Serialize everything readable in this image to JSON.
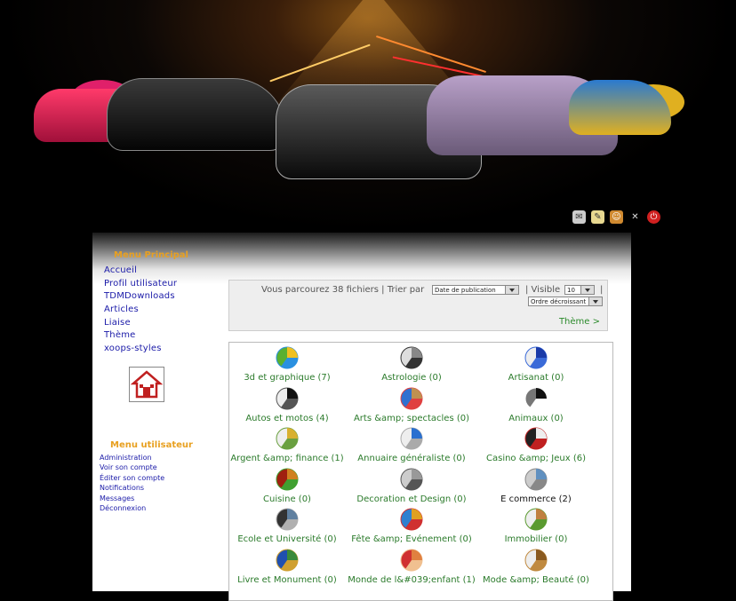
{
  "header_icons": [
    "chat-icon",
    "notes-icon",
    "users-icon",
    "tools-icon",
    "power-icon"
  ],
  "sidebar": {
    "main_menu_title": "Menu Principal",
    "main_menu": [
      "Accueil",
      "Profil utilisateur",
      "TDMDownloads",
      "Articles",
      "Liaise",
      "Thème",
      "xoops-styles"
    ],
    "user_menu_title": "Menu utilisateur",
    "user_menu": [
      "Administration",
      "Voir son compte",
      "Éditer son compte",
      "Notifications",
      "Messages",
      "Déconnexion"
    ]
  },
  "toolbar": {
    "browse_text": "Vous parcourez 38 fichiers | Trier par",
    "sort_value": "Date de publication",
    "visible_label": "| Visible",
    "visible_value": "10",
    "sep": "|",
    "order_value": "Ordre décroissant",
    "theme_link": "Thème >"
  },
  "categories": [
    {
      "label": "3d et graphique (7)",
      "icon": "pie-chart-icon",
      "colors": [
        "#f0c020",
        "#2a90e0",
        "#5ab030"
      ]
    },
    {
      "label": "Astrologie (0)",
      "icon": "zodiac-icon",
      "colors": [
        "#888",
        "#333",
        "#ddd"
      ]
    },
    {
      "label": "Artisanat (0)",
      "icon": "craft-icon",
      "colors": [
        "#1a3aa8",
        "#3a6ad8",
        "#eee"
      ]
    },
    {
      "label": "Autos et motos (4)",
      "icon": "car-icon",
      "colors": [
        "#111",
        "#555",
        "#eee"
      ]
    },
    {
      "label": "Arts &amp; spectacles (0)",
      "icon": "palette-icon",
      "colors": [
        "#c09050",
        "#e04040",
        "#3070d0"
      ]
    },
    {
      "label": "Animaux (0)",
      "icon": "panda-icon",
      "colors": [
        "#111",
        "#fff",
        "#777"
      ]
    },
    {
      "label": "Argent &amp; finance (1)",
      "icon": "money-icon",
      "colors": [
        "#d8b030",
        "#6aa040",
        "#eee"
      ]
    },
    {
      "label": "Annuaire généraliste (0)",
      "icon": "search-icon",
      "colors": [
        "#2a70d0",
        "#aaa",
        "#eee"
      ]
    },
    {
      "label": "Casino &amp; Jeux (6)",
      "icon": "cards-icon",
      "colors": [
        "#eee",
        "#c02020",
        "#222"
      ]
    },
    {
      "label": "Cuisine (0)",
      "icon": "burger-icon",
      "colors": [
        "#d08020",
        "#40a030",
        "#a02010"
      ]
    },
    {
      "label": "Decoration et Design (0)",
      "icon": "sofa-icon",
      "colors": [
        "#999",
        "#555",
        "#ccc"
      ]
    },
    {
      "label": "E commerce (2)",
      "icon": "cart-icon",
      "colors": [
        "#6090c0",
        "#888",
        "#ccc"
      ]
    },
    {
      "label": "Ecole et Université (0)",
      "icon": "geometry-icon",
      "colors": [
        "#6080a0",
        "#b0b0b0",
        "#333"
      ]
    },
    {
      "label": "Fête &amp; Evénement (0)",
      "icon": "party-icon",
      "colors": [
        "#e0a020",
        "#d03030",
        "#3080d0"
      ]
    },
    {
      "label": "Immobilier (0)",
      "icon": "house-icon",
      "colors": [
        "#c08040",
        "#5a9a30",
        "#eee"
      ]
    },
    {
      "label": "Livre et Monument (0)",
      "icon": "books-icon",
      "colors": [
        "#3a8a3a",
        "#d0a030",
        "#2050b0"
      ]
    },
    {
      "label": "Monde de l&#039;enfant (1)",
      "icon": "girl-icon",
      "colors": [
        "#e08040",
        "#f0c090",
        "#d03030"
      ]
    },
    {
      "label": "Mode &amp; Beauté (0)",
      "icon": "boot-icon",
      "colors": [
        "#8a5a20",
        "#c08a40",
        "#eee"
      ]
    }
  ],
  "colors": {
    "menu_title": "#e8a020",
    "link": "#1a1aa8",
    "category": "#2a7a2a"
  }
}
